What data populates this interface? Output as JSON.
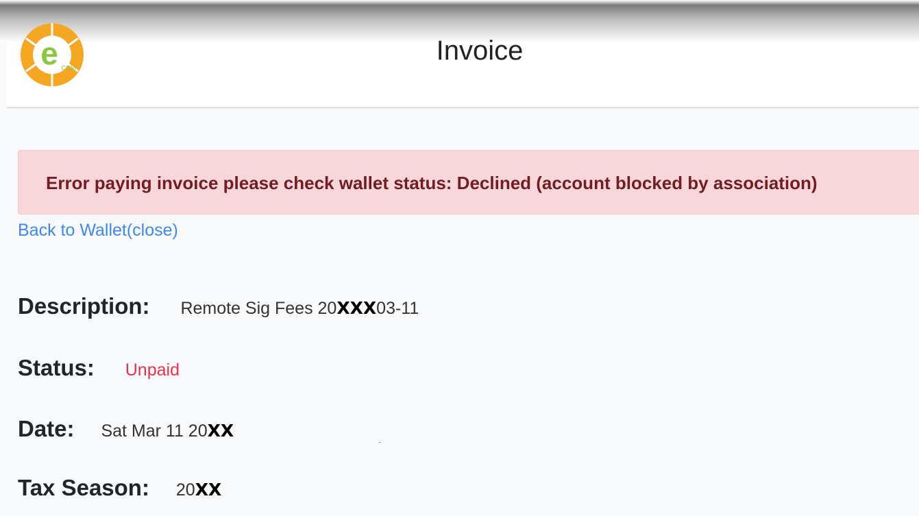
{
  "header": {
    "title": "Invoice",
    "logo_text": "COM",
    "logo_colors": {
      "ring": "#f5a623",
      "inner": "#8dc63f"
    }
  },
  "alert": {
    "message": "Error paying invoice please check wallet status: Declined (account blocked by association)",
    "bg_color": "#f8d7da",
    "text_color": "#721c24"
  },
  "nav": {
    "back_link": "Back to Wallet(close)"
  },
  "invoice": {
    "description": {
      "label": "Description:",
      "value_prefix": "Remote Sig Fees 20",
      "value_mask": "XXX",
      "value_suffix": "03-11"
    },
    "status": {
      "label": "Status:",
      "value": "Unpaid",
      "color": "#e8314d"
    },
    "date": {
      "label": "Date:",
      "value_prefix": "Sat Mar 11 20",
      "value_mask": "XX"
    },
    "tax_season": {
      "label": "Tax Season:",
      "value_prefix": "20",
      "value_mask": "XX"
    }
  }
}
